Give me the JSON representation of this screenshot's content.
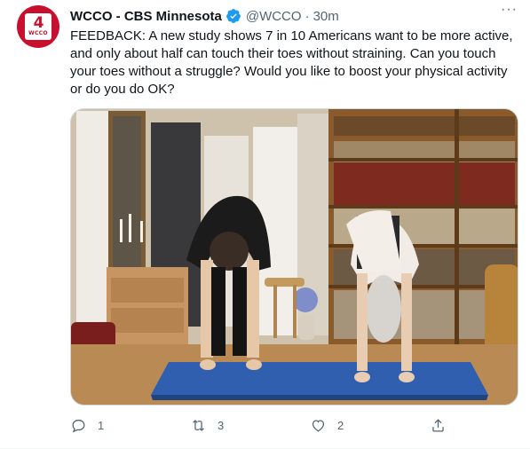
{
  "tweet": {
    "author_name": "WCCO - CBS Minnesota",
    "handle": "@WCCO",
    "separator": "·",
    "time": "30m",
    "more_label": "···",
    "avatar": {
      "channel_number": "4",
      "call_letters": "WCCO",
      "brand_color": "#c8102e"
    },
    "verified": true,
    "text": "FEEDBACK: A new study shows 7 in 10 Americans want to be more active, and only about half can touch their toes without straining. Can you touch your toes without a struggle? Would you like to boost your physical activity or do you do OK?",
    "media": {
      "type": "photo"
    },
    "actions": {
      "reply_count": "1",
      "retweet_count": "3",
      "like_count": "2"
    }
  },
  "colors": {
    "text": "#0f1419",
    "secondary": "#536471",
    "verified": "#1d9bf0",
    "border": "#cfd9de"
  }
}
